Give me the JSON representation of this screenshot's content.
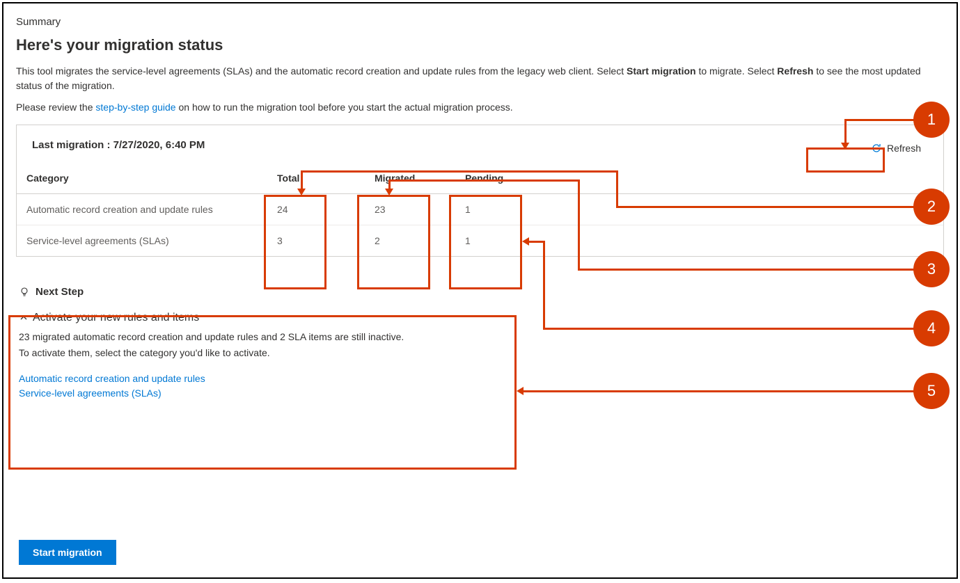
{
  "summary": {
    "label": "Summary",
    "heading": "Here's your migration status",
    "desc1_pre": "This tool migrates the service-level agreements (SLAs) and the automatic record creation and update rules from the legacy web client. Select ",
    "desc1_bold1": "Start migration",
    "desc1_mid": " to migrate. Select ",
    "desc1_bold2": "Refresh",
    "desc1_post": " to see the most updated status of the migration.",
    "desc2_pre": "Please review the ",
    "desc2_link": "step-by-step guide",
    "desc2_post": " on how to run the migration tool before you start the actual migration process."
  },
  "panel": {
    "last_migration_label": "Last migration : 7/27/2020, 6:40 PM",
    "refresh_label": "Refresh",
    "headers": {
      "category": "Category",
      "total": "Total",
      "migrated": "Migrated",
      "pending": "Pending"
    },
    "rows": [
      {
        "category": "Automatic record creation and update rules",
        "total": "24",
        "migrated": "23",
        "pending": "1"
      },
      {
        "category": "Service-level agreements (SLAs)",
        "total": "3",
        "migrated": "2",
        "pending": "1"
      }
    ]
  },
  "next_step": {
    "label": "Next Step",
    "activate_heading": "Activate your new rules and items",
    "activate_line1": "23 migrated automatic record creation and update rules and 2 SLA items are still inactive.",
    "activate_line2": "To activate them, select the category you'd like to activate.",
    "link1": "Automatic record creation and update rules",
    "link2": "Service-level agreements (SLAs)"
  },
  "buttons": {
    "start_migration": "Start migration"
  },
  "annotations": {
    "1": "1",
    "2": "2",
    "3": "3",
    "4": "4",
    "5": "5"
  }
}
